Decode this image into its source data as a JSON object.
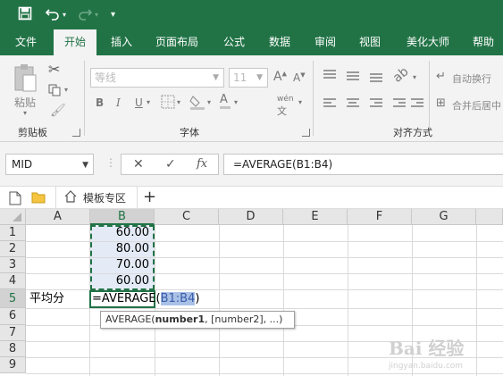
{
  "quick_access": {
    "save": "save-icon",
    "undo": "undo-icon",
    "redo": "redo-icon",
    "customize": "customize-icon"
  },
  "ribbon_tabs": [
    "文件",
    "开始",
    "插入",
    "页面布局",
    "公式",
    "数据",
    "审阅",
    "视图",
    "美化大师",
    "帮助"
  ],
  "active_tab": "开始",
  "ribbon": {
    "clipboard": {
      "label": "剪贴板",
      "paste": "粘贴"
    },
    "font": {
      "label": "字体",
      "font_name": "等线",
      "font_size": "11",
      "bold": "B",
      "italic": "I",
      "underline": "U"
    },
    "alignment": {
      "label": "对齐方式",
      "wrap_text": "自动换行",
      "merge_center": "合并后居中"
    }
  },
  "formula_bar": {
    "name_box": "MID",
    "cancel": "✕",
    "enter": "✓",
    "fx": "fx",
    "formula": "=AVERAGE(B1:B4)"
  },
  "workbook_tabs": {
    "template_tab": "模板专区",
    "add": "+"
  },
  "grid": {
    "columns": [
      "A",
      "B",
      "C",
      "D",
      "E",
      "F",
      "G"
    ],
    "rows": [
      "1",
      "2",
      "3",
      "4",
      "5",
      "6",
      "7",
      "8",
      "9"
    ],
    "cells": {
      "B1": "60.00",
      "B2": "80.00",
      "B3": "70.00",
      "B4": "60.00",
      "A5": "平均分"
    },
    "edit": {
      "prefix": "=AVERAGE(",
      "ref": "B1:B4",
      "suffix": ")"
    },
    "tooltip": {
      "func": "AVERAGE(",
      "arg1": "number1",
      "rest": ", [number2], ...)"
    }
  },
  "watermark": {
    "text": "Bai 经验",
    "sub": "jingyan.baidu.com"
  },
  "colors": {
    "accent": "#217346",
    "selection": "#e4ebf6",
    "ref_highlight": "#a9c1e6"
  }
}
